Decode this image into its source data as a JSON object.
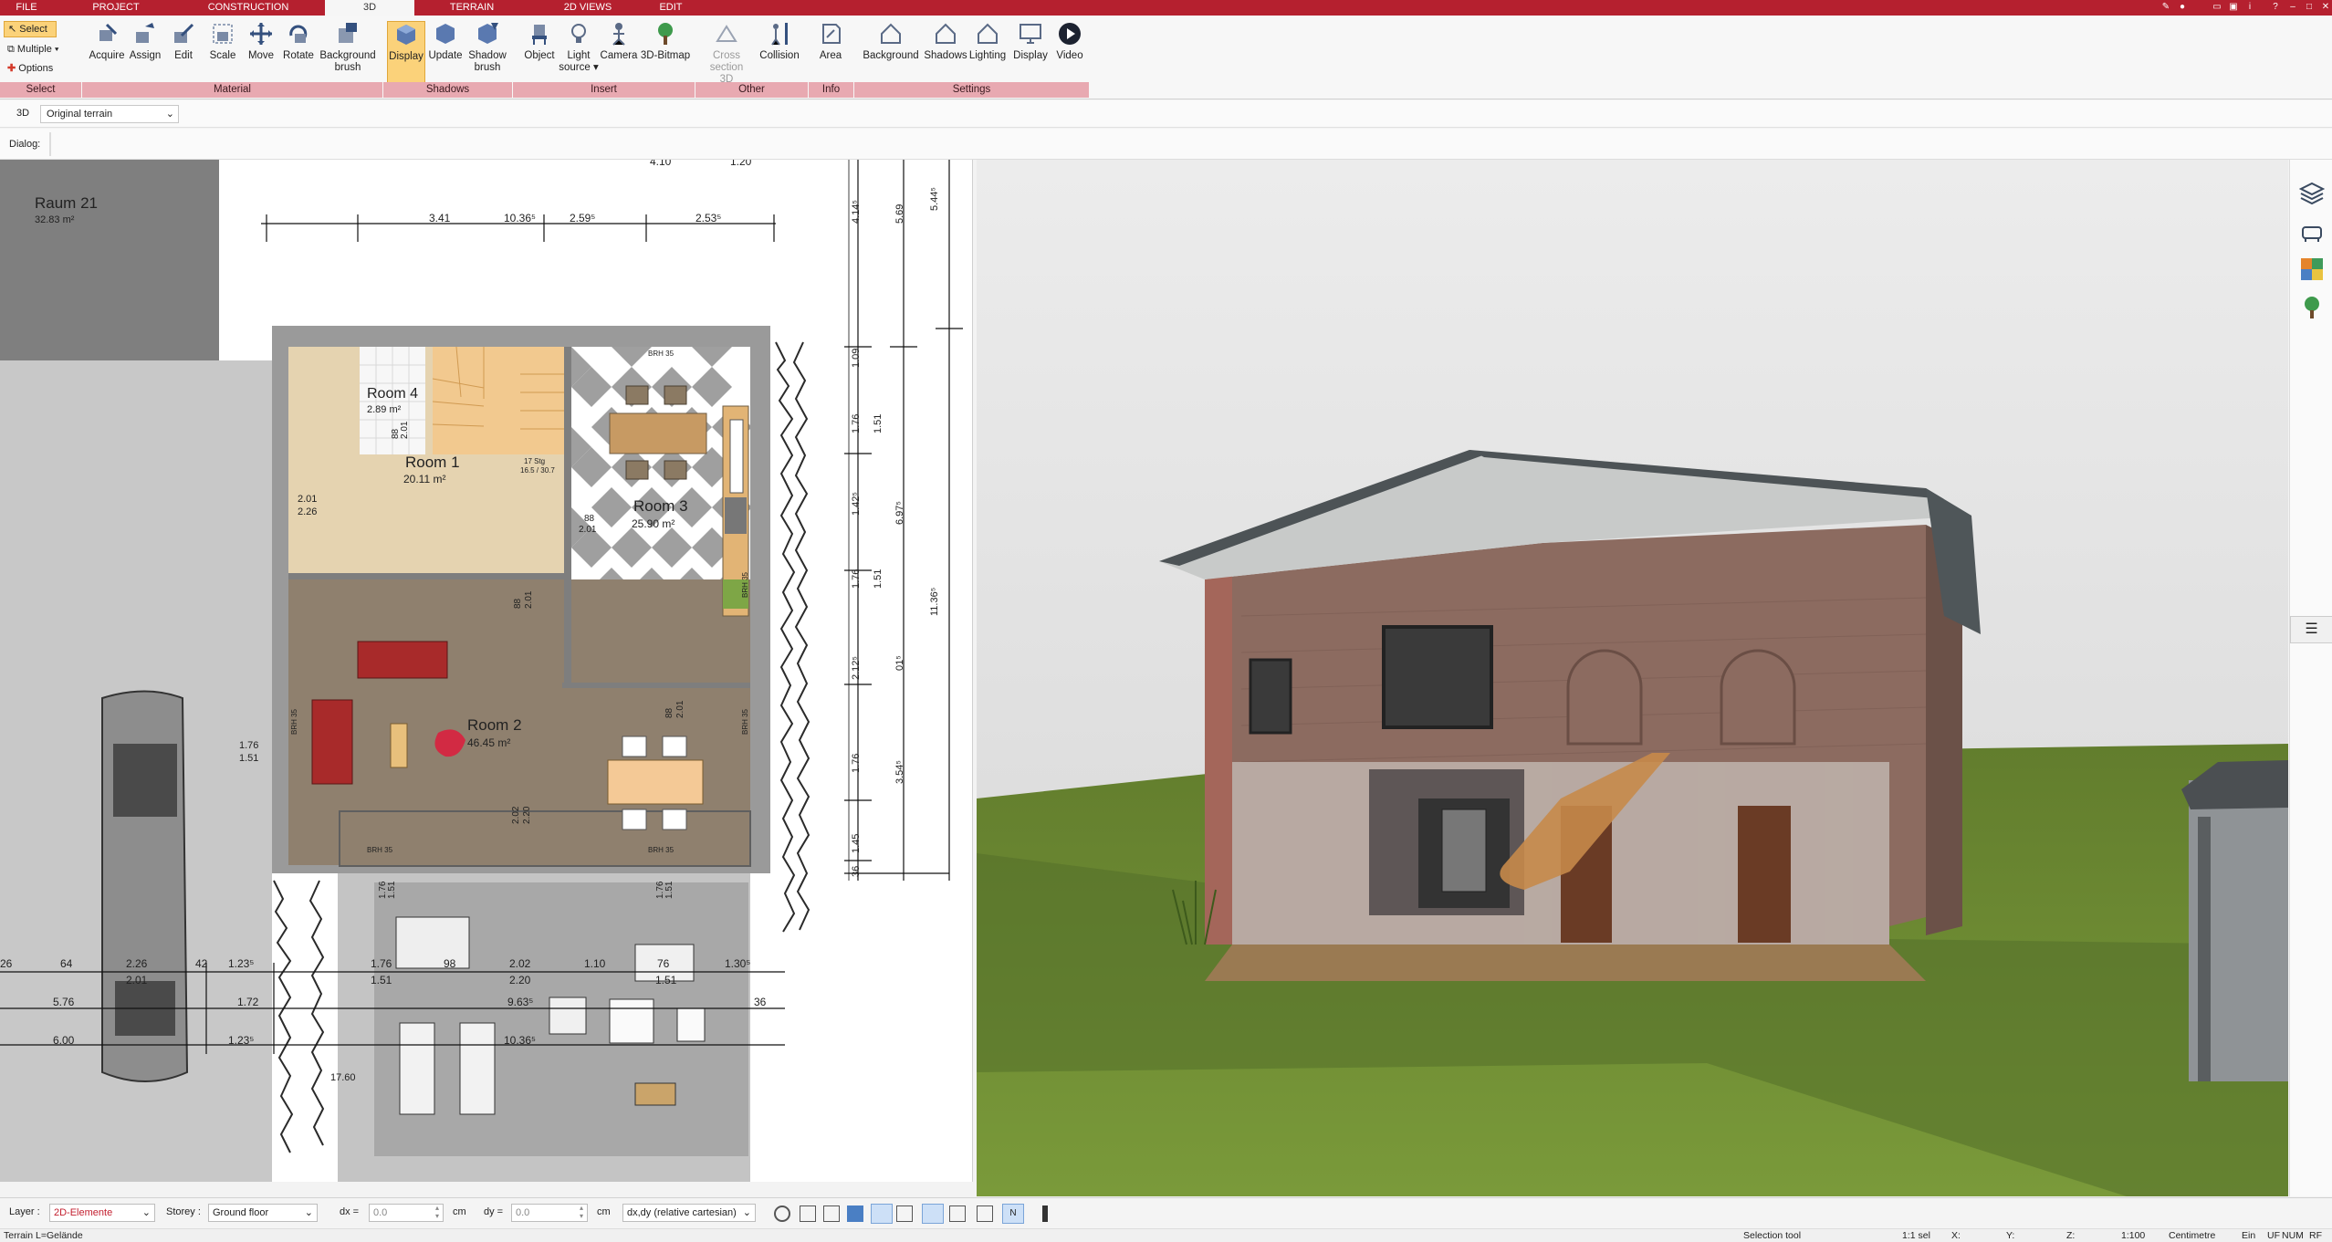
{
  "menubar": {
    "tabs": [
      {
        "label": "FILE"
      },
      {
        "label": "PROJECT"
      },
      {
        "label": "CONSTRUCTION"
      },
      {
        "label": "3D"
      },
      {
        "label": "TERRAIN"
      },
      {
        "label": "2D VIEWS"
      },
      {
        "label": "EDIT"
      }
    ]
  },
  "ribbon": {
    "select": {
      "select": "Select",
      "multiple": "Multiple",
      "options": "Options"
    },
    "buttons": {
      "acquire": "Acquire",
      "assign": "Assign",
      "edit": "Edit",
      "scale": "Scale",
      "move": "Move",
      "rotate": "Rotate",
      "background_brush_1": "Background",
      "background_brush_2": "brush",
      "display": "Display",
      "update": "Update",
      "shadow_brush_1": "Shadow",
      "shadow_brush_2": "brush",
      "object": "Object",
      "light_source_1": "Light",
      "light_source_2": "source",
      "camera": "Camera",
      "bitmap": "3D-Bitmap",
      "cross_section_1": "Cross",
      "cross_section_2": "section 3D",
      "collision": "Collision",
      "area": "Area",
      "background": "Background",
      "shadows": "Shadows",
      "lighting": "Lighting",
      "display2": "Display",
      "video": "Video"
    },
    "groups": {
      "select": "Select",
      "material": "Material",
      "shadows": "Shadows",
      "insert": "Insert",
      "other": "Other",
      "info": "Info",
      "settings": "Settings"
    }
  },
  "viewbar": {
    "mode": "3D",
    "terrain": "Original terrain"
  },
  "dialogbar": {
    "label": "Dialog:"
  },
  "plan": {
    "rooms": [
      {
        "name": "Raum 21",
        "area": "32.83 m²"
      },
      {
        "name": "Room 4",
        "area": "2.89 m²"
      },
      {
        "name": "Room 1",
        "area": "20.11 m²"
      },
      {
        "name": "Room 3",
        "area": "25.90 m²"
      },
      {
        "name": "Room 2",
        "area": "46.45 m²"
      }
    ],
    "top_dims": [
      "3.41",
      "10.36⁵",
      "2.59⁵",
      "2.53⁵"
    ],
    "top_cut": [
      "4.10",
      "1.20"
    ],
    "right_dims_a": [
      "4.14⁵",
      "1.09",
      "1.76",
      "1.42⁵",
      "1.76",
      "2.12⁵",
      "1.76",
      "1.45",
      "36"
    ],
    "right_dims_b": [
      "5.69",
      "1.51",
      "6.97⁵",
      "1.51",
      "01⁵",
      "3.54⁵"
    ],
    "right_dims_c": [
      "5.44⁵",
      "11.36⁵"
    ],
    "bottom_row1": [
      "26",
      "64",
      "2.26",
      "42",
      "1.23⁵",
      "1.76",
      "98",
      "2.02",
      "1.10",
      "76",
      "1.30⁵"
    ],
    "bottom_row1b": [
      "2.01",
      "1.51",
      "2.20",
      "1.51"
    ],
    "bottom_row2": [
      "5.76",
      "1.72",
      "9.63⁵",
      "36"
    ],
    "bottom_row3": [
      "6.00",
      "1.23⁵",
      "10.36⁵"
    ],
    "misc": [
      "1.76",
      "1.51",
      "2.01",
      "2.26",
      "88",
      "2.01",
      "17.60",
      "BRH 35",
      "BRH 35",
      "BRH 35",
      "BRH 35",
      "BRH 35",
      "BRH 35",
      "17 Stg",
      "16.5 / 30.7",
      "2.02",
      "2.20",
      "1.76",
      "1.51",
      "1.76",
      "1.51",
      "88",
      "2.01",
      "88",
      "2.01",
      "88",
      "2.01"
    ]
  },
  "bottombar": {
    "layer_label": "Layer :",
    "layer_value": "2D-Elemente",
    "storey_label": "Storey :",
    "storey_value": "Ground floor",
    "dx_label": "dx =",
    "dx_value": "0.0",
    "dx_unit": "cm",
    "dy_label": "dy =",
    "dy_value": "0.0",
    "dy_unit": "cm",
    "coord_mode": "dx,dy (relative cartesian)"
  },
  "statusbar": {
    "terrain": "Terrain L=Gelände",
    "tool": "Selection tool",
    "sel": "1:1 sel",
    "x": "X:",
    "y": "Y:",
    "z": "Z:",
    "scale": "1:100",
    "unit": "Centimetre",
    "ein": "Ein",
    "uf": "UF",
    "num": "NUM",
    "rf": "RF"
  },
  "colors": {
    "accent": "#b5202f",
    "group": "#e8a9b1",
    "active": "#fbd27a"
  }
}
